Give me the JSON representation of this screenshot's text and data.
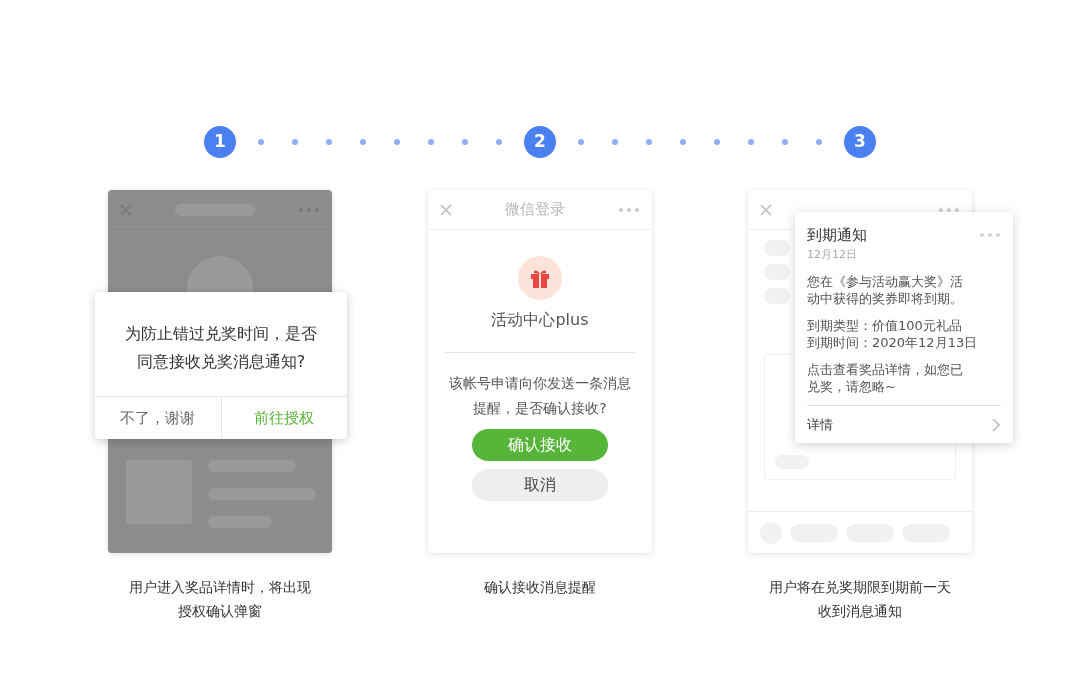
{
  "steps": [
    {
      "label": "1"
    },
    {
      "label": "2"
    },
    {
      "label": "3"
    }
  ],
  "panels": [
    {
      "kind": "dim-dialog",
      "dialog": {
        "message_lines": [
          "为防止错过兑奖时间，是否",
          "同意接收兑奖消息通知?"
        ],
        "buttons": [
          {
            "label": "不了，谢谢",
            "kind": "secondary"
          },
          {
            "label": "前往授权",
            "kind": "primary"
          }
        ]
      },
      "caption_lines": [
        "用户进入奖品详情时，将出现",
        "授权确认弹窗"
      ]
    },
    {
      "kind": "login",
      "title": "微信登录",
      "account_name": "活动中心plus",
      "message": "该帐号申请向你发送一条消息提醒，是否确认接收?",
      "buttons": [
        {
          "label": "确认接收",
          "kind": "primary"
        },
        {
          "label": "取消",
          "kind": "secondary"
        }
      ],
      "caption_lines": [
        "确认接收消息提醒"
      ]
    },
    {
      "kind": "notice",
      "notice": {
        "title": "到期通知",
        "date": "12月12日",
        "paragraphs": [
          [
            "您在《参与活动赢大奖》活",
            "动中获得的奖券即将到期。"
          ],
          [
            "到期类型：价值100元礼品",
            "到期时间：2020年12月13日"
          ],
          [
            "点击查看奖品详情，如您已",
            "兑奖，请忽略~"
          ]
        ],
        "link": "详情"
      },
      "caption_lines": [
        "用户将在兑奖期限到期前一天",
        "收到消息通知"
      ]
    }
  ]
}
